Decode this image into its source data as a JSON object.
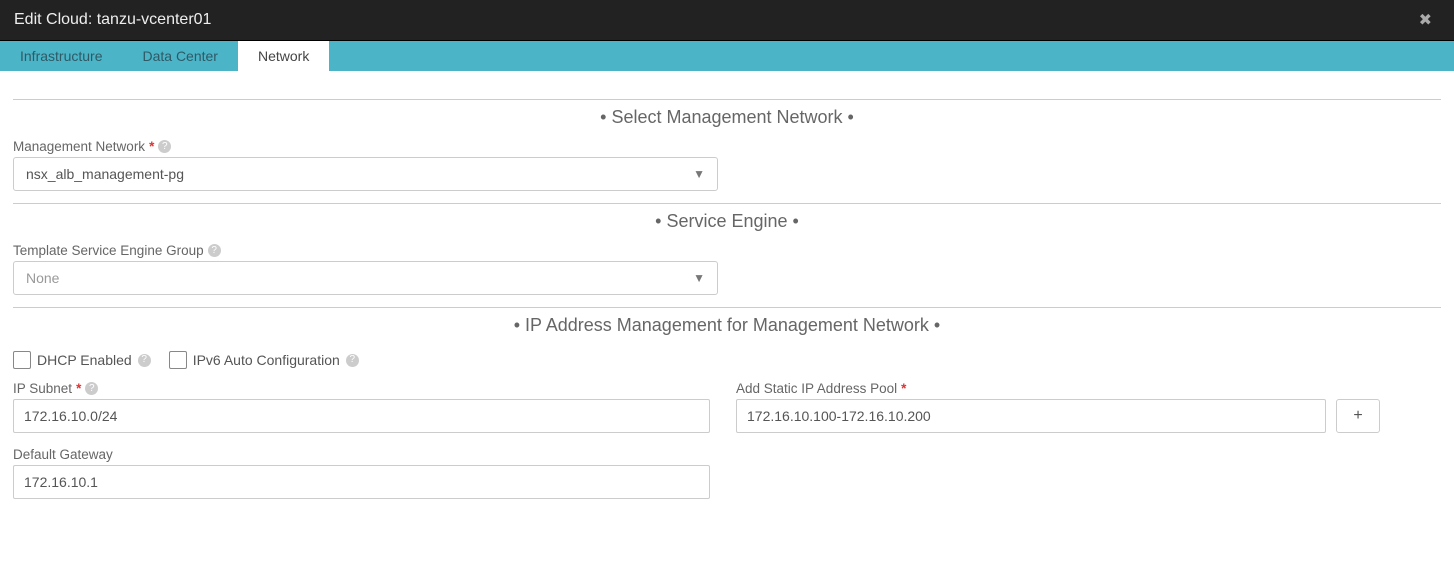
{
  "title": "Edit Cloud: tanzu-vcenter01",
  "tabs": {
    "infra": "Infrastructure",
    "dc": "Data Center",
    "net": "Network"
  },
  "sections": {
    "mgmt_net": "• Select Management Network •",
    "se": "• Service Engine •",
    "ipam": "• IP Address Management for Management Network •"
  },
  "labels": {
    "mgmt_network": "Management Network",
    "tmpl_seg": "Template Service Engine Group",
    "dhcp": "DHCP Enabled",
    "ipv6": "IPv6 Auto Configuration",
    "ip_subnet": "IP Subnet",
    "static_pool": "Add Static IP Address Pool",
    "gateway": "Default Gateway"
  },
  "values": {
    "mgmt_network": "nsx_alb_management-pg",
    "tmpl_seg_placeholder": "None",
    "ip_subnet": "172.16.10.0/24",
    "static_pool": "172.16.10.100-172.16.10.200",
    "gateway": "172.16.10.1"
  }
}
